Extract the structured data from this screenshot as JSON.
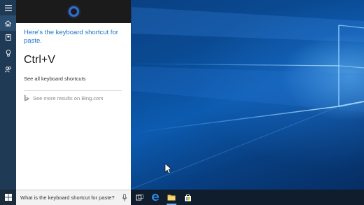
{
  "cortana": {
    "answer_text": "Here's the keyboard shortcut for paste.",
    "shortcut": "Ctrl+V",
    "see_all_link": "See all keyboard shortcuts",
    "bing_link": "See more results on Bing.com"
  },
  "sidebar": {
    "items": [
      {
        "icon": "hamburger-menu-icon"
      },
      {
        "icon": "home-icon"
      },
      {
        "icon": "notebook-icon"
      },
      {
        "icon": "lightbulb-icon"
      },
      {
        "icon": "feedback-icon"
      }
    ]
  },
  "taskbar": {
    "search_query": "What is the keyboard shortcut for paste?",
    "pinned": [
      {
        "icon": "task-view-icon"
      },
      {
        "icon": "edge-icon"
      },
      {
        "icon": "file-explorer-icon"
      },
      {
        "icon": "store-icon"
      }
    ]
  },
  "colors": {
    "accent": "#1a75c8",
    "cortana_ring": "#2f6fd4",
    "taskbar": "#0f1d2c",
    "rail": "#1f3a55"
  }
}
